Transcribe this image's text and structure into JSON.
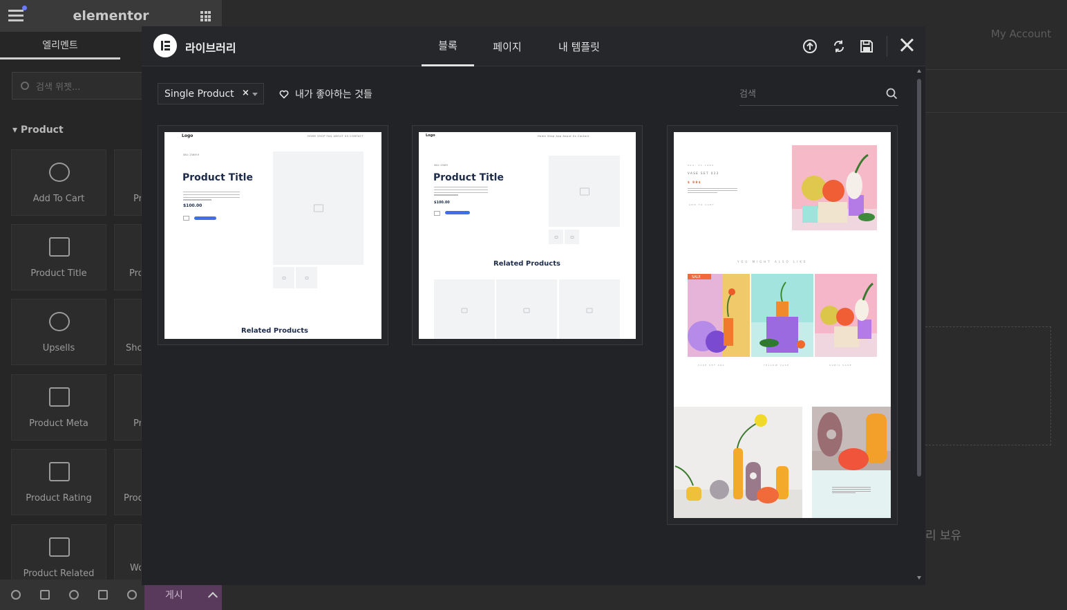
{
  "editor": {
    "logo": "elementor",
    "panel_tab": "엘리멘트",
    "search_placeholder": "검색 위젯...",
    "category": "Product",
    "widgets": [
      {
        "label": "Add To Cart",
        "icon": "add-to-cart-icon"
      },
      {
        "label": "Product Title",
        "icon": "product-title-icon"
      },
      {
        "label": "Upsells",
        "icon": "upsells-icon"
      },
      {
        "label": "Product Meta",
        "icon": "product-meta-icon"
      },
      {
        "label": "Product Rating",
        "icon": "product-rating-icon"
      },
      {
        "label": "Product Related",
        "icon": "product-related-icon"
      }
    ],
    "widgets_right_partial": [
      "Pr",
      "Pro",
      "Sho",
      "Pr",
      "Prod",
      "Wo"
    ],
    "publish_label": "게시",
    "preview_account": "My Account",
    "preview_text": "리 보유"
  },
  "modal": {
    "title": "라이브러리",
    "tabs": [
      {
        "label": "블록",
        "active": true
      },
      {
        "label": "페이지",
        "active": false
      },
      {
        "label": "내 템플릿",
        "active": false
      }
    ],
    "header_icons": [
      "upload-icon",
      "sync-icon",
      "save-icon",
      "close-icon"
    ],
    "filter_value": "Single Product",
    "favorites_label": "내가 좋아하는 것들",
    "search_placeholder": "검색",
    "cards": [
      {
        "logo": "Logo",
        "nav": "HOME  SHOP  FAQ  ABOUT US  CONTACT",
        "sku": "SKU: 2565Y-9",
        "title": "Product Title",
        "price": "$100.00",
        "related": "Related Products"
      },
      {
        "logo": "Logo",
        "nav": "Home   Shop   App   About Us   Contact",
        "sku": "SKU: 2565Y",
        "title": "Product Title",
        "price": "$100.00",
        "related": "Related Products"
      },
      {
        "product_name": "VASE SET 022",
        "price": "$ 99$",
        "add": "ADD TO CART",
        "section": "YOU MIGHT ALSO LIKE",
        "sale": "SALE",
        "items": [
          "VASE SET 004",
          "YELLOW VASE",
          "CUBIC VASE"
        ]
      }
    ]
  }
}
